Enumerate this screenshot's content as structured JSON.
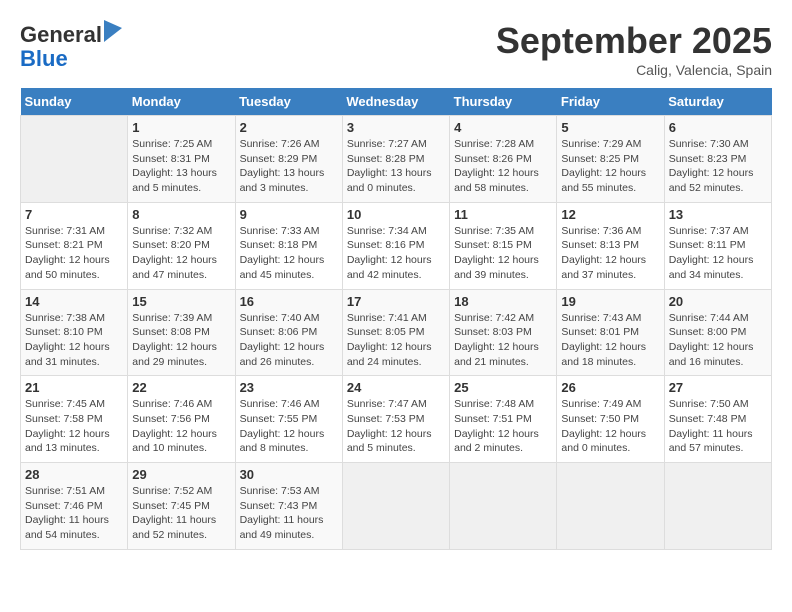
{
  "header": {
    "logo_line1": "General",
    "logo_line2": "Blue",
    "month": "September 2025",
    "location": "Calig, Valencia, Spain"
  },
  "weekdays": [
    "Sunday",
    "Monday",
    "Tuesday",
    "Wednesday",
    "Thursday",
    "Friday",
    "Saturday"
  ],
  "weeks": [
    [
      {
        "day": "",
        "info": ""
      },
      {
        "day": "1",
        "info": "Sunrise: 7:25 AM\nSunset: 8:31 PM\nDaylight: 13 hours\nand 5 minutes."
      },
      {
        "day": "2",
        "info": "Sunrise: 7:26 AM\nSunset: 8:29 PM\nDaylight: 13 hours\nand 3 minutes."
      },
      {
        "day": "3",
        "info": "Sunrise: 7:27 AM\nSunset: 8:28 PM\nDaylight: 13 hours\nand 0 minutes."
      },
      {
        "day": "4",
        "info": "Sunrise: 7:28 AM\nSunset: 8:26 PM\nDaylight: 12 hours\nand 58 minutes."
      },
      {
        "day": "5",
        "info": "Sunrise: 7:29 AM\nSunset: 8:25 PM\nDaylight: 12 hours\nand 55 minutes."
      },
      {
        "day": "6",
        "info": "Sunrise: 7:30 AM\nSunset: 8:23 PM\nDaylight: 12 hours\nand 52 minutes."
      }
    ],
    [
      {
        "day": "7",
        "info": "Sunrise: 7:31 AM\nSunset: 8:21 PM\nDaylight: 12 hours\nand 50 minutes."
      },
      {
        "day": "8",
        "info": "Sunrise: 7:32 AM\nSunset: 8:20 PM\nDaylight: 12 hours\nand 47 minutes."
      },
      {
        "day": "9",
        "info": "Sunrise: 7:33 AM\nSunset: 8:18 PM\nDaylight: 12 hours\nand 45 minutes."
      },
      {
        "day": "10",
        "info": "Sunrise: 7:34 AM\nSunset: 8:16 PM\nDaylight: 12 hours\nand 42 minutes."
      },
      {
        "day": "11",
        "info": "Sunrise: 7:35 AM\nSunset: 8:15 PM\nDaylight: 12 hours\nand 39 minutes."
      },
      {
        "day": "12",
        "info": "Sunrise: 7:36 AM\nSunset: 8:13 PM\nDaylight: 12 hours\nand 37 minutes."
      },
      {
        "day": "13",
        "info": "Sunrise: 7:37 AM\nSunset: 8:11 PM\nDaylight: 12 hours\nand 34 minutes."
      }
    ],
    [
      {
        "day": "14",
        "info": "Sunrise: 7:38 AM\nSunset: 8:10 PM\nDaylight: 12 hours\nand 31 minutes."
      },
      {
        "day": "15",
        "info": "Sunrise: 7:39 AM\nSunset: 8:08 PM\nDaylight: 12 hours\nand 29 minutes."
      },
      {
        "day": "16",
        "info": "Sunrise: 7:40 AM\nSunset: 8:06 PM\nDaylight: 12 hours\nand 26 minutes."
      },
      {
        "day": "17",
        "info": "Sunrise: 7:41 AM\nSunset: 8:05 PM\nDaylight: 12 hours\nand 24 minutes."
      },
      {
        "day": "18",
        "info": "Sunrise: 7:42 AM\nSunset: 8:03 PM\nDaylight: 12 hours\nand 21 minutes."
      },
      {
        "day": "19",
        "info": "Sunrise: 7:43 AM\nSunset: 8:01 PM\nDaylight: 12 hours\nand 18 minutes."
      },
      {
        "day": "20",
        "info": "Sunrise: 7:44 AM\nSunset: 8:00 PM\nDaylight: 12 hours\nand 16 minutes."
      }
    ],
    [
      {
        "day": "21",
        "info": "Sunrise: 7:45 AM\nSunset: 7:58 PM\nDaylight: 12 hours\nand 13 minutes."
      },
      {
        "day": "22",
        "info": "Sunrise: 7:46 AM\nSunset: 7:56 PM\nDaylight: 12 hours\nand 10 minutes."
      },
      {
        "day": "23",
        "info": "Sunrise: 7:46 AM\nSunset: 7:55 PM\nDaylight: 12 hours\nand 8 minutes."
      },
      {
        "day": "24",
        "info": "Sunrise: 7:47 AM\nSunset: 7:53 PM\nDaylight: 12 hours\nand 5 minutes."
      },
      {
        "day": "25",
        "info": "Sunrise: 7:48 AM\nSunset: 7:51 PM\nDaylight: 12 hours\nand 2 minutes."
      },
      {
        "day": "26",
        "info": "Sunrise: 7:49 AM\nSunset: 7:50 PM\nDaylight: 12 hours\nand 0 minutes."
      },
      {
        "day": "27",
        "info": "Sunrise: 7:50 AM\nSunset: 7:48 PM\nDaylight: 11 hours\nand 57 minutes."
      }
    ],
    [
      {
        "day": "28",
        "info": "Sunrise: 7:51 AM\nSunset: 7:46 PM\nDaylight: 11 hours\nand 54 minutes."
      },
      {
        "day": "29",
        "info": "Sunrise: 7:52 AM\nSunset: 7:45 PM\nDaylight: 11 hours\nand 52 minutes."
      },
      {
        "day": "30",
        "info": "Sunrise: 7:53 AM\nSunset: 7:43 PM\nDaylight: 11 hours\nand 49 minutes."
      },
      {
        "day": "",
        "info": ""
      },
      {
        "day": "",
        "info": ""
      },
      {
        "day": "",
        "info": ""
      },
      {
        "day": "",
        "info": ""
      }
    ]
  ]
}
